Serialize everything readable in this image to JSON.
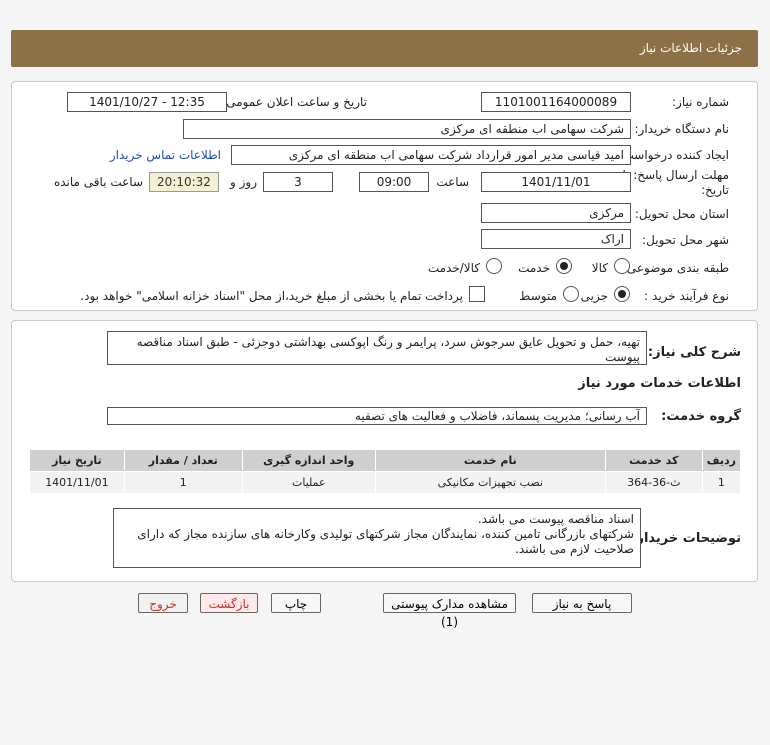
{
  "header": {
    "title": "جزئیات اطلاعات نیاز"
  },
  "info": {
    "need_number_label": "شماره نیاز:",
    "need_number": "1101001164000089",
    "announce_label": "تاریخ و ساعت اعلان عمومی:",
    "announce_value": "1401/10/27 - 12:35",
    "buyer_org_label": "نام دستگاه خریدار:",
    "buyer_org": "شرکت سهامی اب منطقه ای مرکزی",
    "requester_label": "ایجاد کننده درخواست:",
    "requester": "امید قیاسی مدیر امور قرارداد شرکت سهامی اب منطقه ای مرکزی",
    "contact_link": "اطلاعات تماس خریدار",
    "deadline_label_1": "مهلت ارسال پاسخ: تا",
    "deadline_label_2": "تاریخ:",
    "deadline_date": "1401/11/01",
    "time_label": "ساعت",
    "deadline_time": "09:00",
    "days_value": "3",
    "days_label": "روز و",
    "remaining_time": "20:10:32",
    "remaining_label": "ساعت باقی مانده",
    "province_label": "استان محل تحویل:",
    "province": "مرکزی",
    "city_label": "شهر محل تحویل:",
    "city": "اراک",
    "category_label": "طبقه بندی موضوعی:",
    "category_options": [
      "کالا",
      "خدمت",
      "کالا/خدمت"
    ],
    "category_selected": "خدمت",
    "process_label": "نوع فرآیند خرید :",
    "process_options": [
      "جزیی",
      "متوسط"
    ],
    "process_selected": "جزیی",
    "payment_note": "پرداخت تمام یا بخشی از مبلغ خرید،از محل \"اسناد خزانه اسلامی\" خواهد بود."
  },
  "desc": {
    "summary_label": "شرح کلی نیاز:",
    "summary": "تهیه، حمل و تحویل عایق سرجوش سرد، پرایمر و رنگ اپوکسی بهداشتی دوجزئی - طبق اسناد مناقصه پیوست",
    "services_title": "اطلاعات خدمات مورد نیاز",
    "service_group_label": "گروه خدمت:",
    "service_group": "آب رسانی؛ مدیریت پسماند، فاضلاب و فعالیت های تصفیه",
    "table": {
      "headers": [
        "ردیف",
        "کد خدمت",
        "نام خدمت",
        "واحد اندازه گیری",
        "تعداد / مقدار",
        "تاریخ نیاز"
      ],
      "rows": [
        [
          "1",
          "ث-36-364",
          "نصب تجهیزات مکانیکی",
          "عملیات",
          "1",
          "1401/11/01"
        ]
      ]
    },
    "buyer_notes_label": "توضیحات خریدار:",
    "buyer_notes": "اسناد مناقصه پیوست می باشد.\nشرکتهای بازرگانی تامین کننده، نمایندگان مجاز شرکتهای تولیدی وکارخانه های سازنده مجاز که دارای صلاحیت لازم می باشند."
  },
  "buttons": {
    "reply": "پاسخ به نیاز",
    "view_docs": "مشاهده مدارک پیوستی (1)",
    "print": "چاپ",
    "back": "بازگشت",
    "exit": "خروج"
  }
}
